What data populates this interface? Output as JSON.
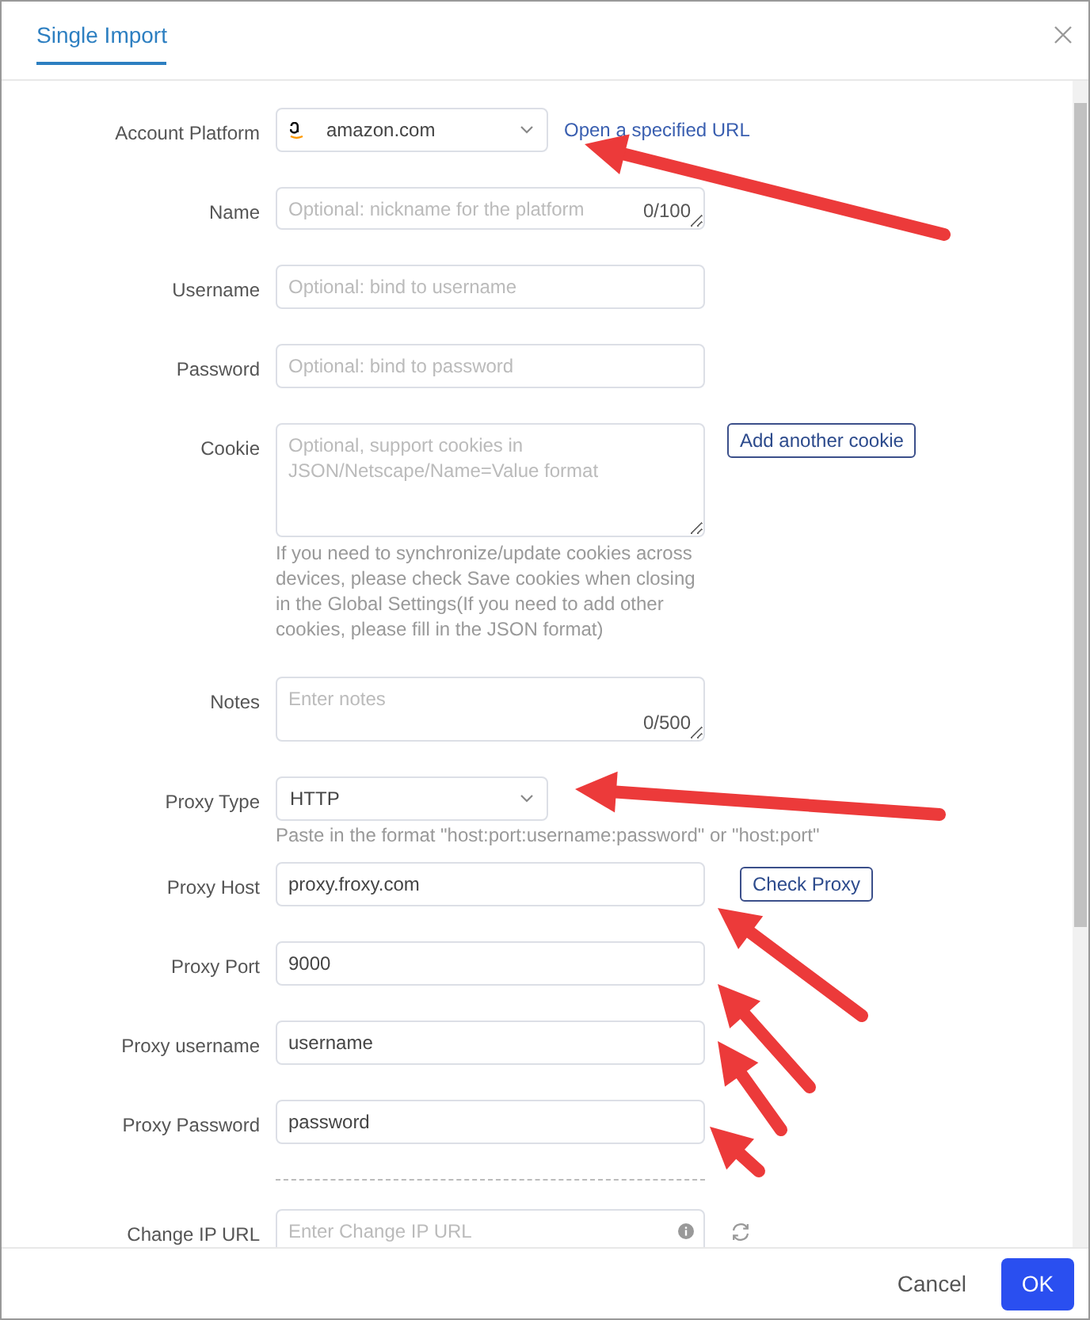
{
  "dialog": {
    "title": "Single Import",
    "tab_selected": true
  },
  "fields": [
    {
      "kind": "platform-select",
      "label": "Account Platform",
      "value": "amazon.com",
      "link": "Open a specified URL"
    },
    {
      "kind": "line-area",
      "label": "Name",
      "placeholder": "Optional: nickname for the platform",
      "counter": "0/100"
    },
    {
      "kind": "text",
      "label": "Username",
      "placeholder": "Optional: bind to username"
    },
    {
      "kind": "text",
      "label": "Password",
      "placeholder": "Optional: bind to password"
    },
    {
      "kind": "area",
      "label": "Cookie",
      "placeholder": "Optional, support cookies in\nJSON/Netscape/Name=Value format",
      "button": "Add another cookie",
      "help": "If you need to synchronize/update cookies across devices, please check Save cookies when closing in the Global Settings(If you need to add other cookies, please fill in the JSON format)"
    },
    {
      "kind": "notes-area",
      "label": "Notes",
      "placeholder": "Enter notes",
      "counter": "0/500"
    },
    {
      "kind": "select",
      "label": "Proxy Type",
      "value": "HTTP",
      "help": "Paste in the format \"host:port:username:password\" or \"host:port\""
    },
    {
      "kind": "text",
      "label": "Proxy Host",
      "value": "proxy.froxy.com",
      "button": "Check Proxy"
    },
    {
      "kind": "text",
      "label": "Proxy Port",
      "value": "9000"
    },
    {
      "kind": "text",
      "label": "Proxy username",
      "value": "username"
    },
    {
      "kind": "text",
      "label": "Proxy Password",
      "value": "password"
    },
    {
      "kind": "divider"
    },
    {
      "kind": "url",
      "label": "Change IP URL",
      "placeholder": "Enter Change IP URL"
    }
  ],
  "footer": {
    "buttons": [
      {
        "label": "Cancel",
        "kind": "text"
      },
      {
        "label": "OK",
        "kind": "primary"
      }
    ]
  }
}
